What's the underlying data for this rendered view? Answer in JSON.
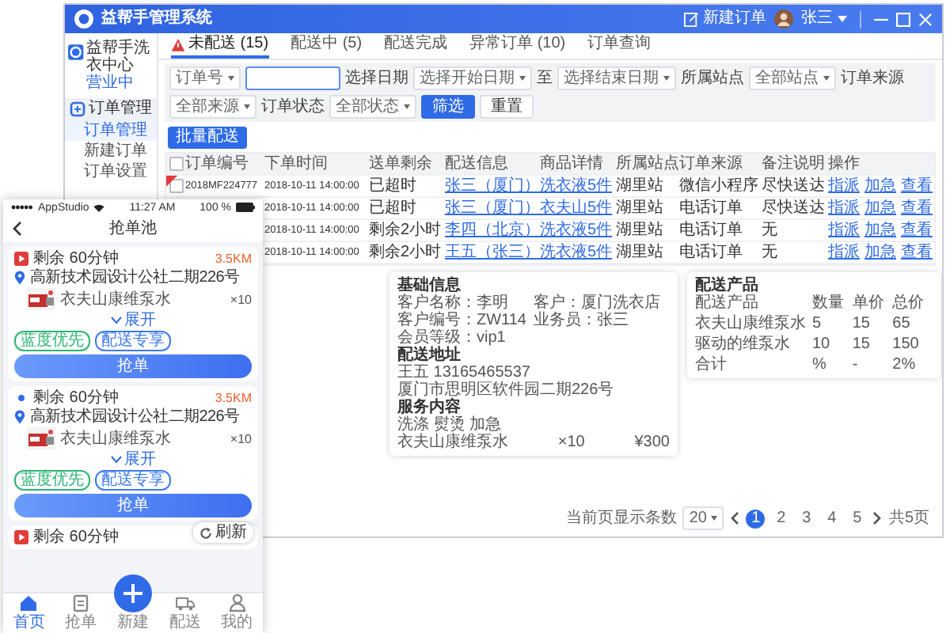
{
  "app": {
    "title": "益帮手管理系统",
    "new_order": "新建订单",
    "user": "张三"
  },
  "sidebar": {
    "shop_name": "益帮手洗衣中心",
    "shop_status": "营业中",
    "sections": [
      {
        "label": "订单管理",
        "expanded": true,
        "children": [
          {
            "label": "订单管理",
            "selected": true
          },
          {
            "label": "新建订单",
            "selected": false
          },
          {
            "label": "订单设置",
            "selected": false
          }
        ]
      }
    ]
  },
  "tabs": [
    {
      "label": "未配送 (15)",
      "alert": true,
      "selected": true
    },
    {
      "label": "配送中 (5)",
      "alert": false,
      "selected": false
    },
    {
      "label": "配送完成",
      "alert": false,
      "selected": false
    },
    {
      "label": "异常订单 (10)",
      "alert": false,
      "selected": false
    },
    {
      "label": "订单查询",
      "alert": false,
      "selected": false
    }
  ],
  "filters": [
    {
      "kind": "select",
      "value": "订单号"
    },
    {
      "kind": "input"
    },
    {
      "kind": "label",
      "text": "选择日期"
    },
    {
      "kind": "select",
      "value": "选择开始日期"
    },
    {
      "kind": "label",
      "text": "至"
    },
    {
      "kind": "select",
      "value": "选择结束日期"
    },
    {
      "kind": "label",
      "text": "所属站点"
    },
    {
      "kind": "select",
      "value": "全部站点"
    },
    {
      "kind": "label",
      "text": "订单来源"
    },
    {
      "kind": "select",
      "value": "全部来源"
    },
    {
      "kind": "label",
      "text": "订单状态"
    },
    {
      "kind": "select",
      "value": "全部状态"
    },
    {
      "kind": "button",
      "text": "筛选",
      "primary": true
    },
    {
      "kind": "button",
      "text": "重置",
      "primary": false
    }
  ],
  "batch_button": "批量配送",
  "table": {
    "all_checked": false,
    "columns": [
      "订单编号",
      "下单时间",
      "送单剩余",
      "配送信息",
      "商品详情",
      "所属站点",
      "订单来源",
      "备注说明",
      "操作"
    ],
    "rows": [
      {
        "flagged": true,
        "checked": false,
        "order_no": "2018MF224777",
        "time": "2018-10-11 14:00:00",
        "remaining": "已超时",
        "delivery": "张三（厦门）",
        "product": "洗衣液5件",
        "station": "湖里站",
        "source": "微信小程序",
        "note": "尽快送达",
        "actions": [
          "指派",
          "加急",
          "查看"
        ]
      },
      {
        "time": "2018-10-11 14:00:00",
        "remaining": "已超时",
        "delivery": "张三（厦门）",
        "product": "衣夫山5件",
        "station": "湖里站",
        "source": "电话订单",
        "note": "尽快送达",
        "actions": [
          "指派",
          "加急",
          "查看"
        ]
      },
      {
        "time": "2018-10-11 14:00:00",
        "remaining": "剩余2小时",
        "delivery": "李四（北京）",
        "product": "洗衣液5件",
        "station": "湖里站",
        "source": "电话订单",
        "note": "无",
        "actions": [
          "指派",
          "加急",
          "查看"
        ]
      },
      {
        "time": "2018-10-11 14:00:00",
        "remaining": "剩余2小时",
        "delivery": "王五（张三）",
        "product": "洗衣液5件",
        "station": "湖里站",
        "source": "电话订单",
        "note": "无",
        "actions": [
          "指派",
          "加急",
          "查看"
        ]
      }
    ]
  },
  "info_card": {
    "title": "基础信息",
    "fields": [
      "客户名称：李明",
      "客户：厦门洗衣店",
      "客户编号：ZW114",
      "业务员：张三",
      "会员等级：vip1"
    ],
    "address_title": "配送地址",
    "contact": "王五  13165465537",
    "address": "厦门市思明区软件园二期226号",
    "service_title": "服务内容",
    "services": "洗涤 熨烫 加急",
    "product": {
      "name": "衣夫山康维泵水",
      "qty": "×10",
      "price": "¥300"
    }
  },
  "products_card": {
    "title": "配送产品",
    "columns": [
      "配送产品",
      "数量",
      "单价",
      "总价"
    ],
    "rows": [
      [
        "衣夫山康维泵水",
        "5",
        "15",
        "65"
      ],
      [
        "驱动的维泵水",
        "10",
        "15",
        "150"
      ],
      [
        "合计",
        "%",
        "-",
        "2%"
      ]
    ]
  },
  "pagination": {
    "label": "当前页显示条数",
    "size": "20",
    "pages": [
      {
        "label": "1",
        "selected": true
      },
      {
        "label": "2",
        "selected": false
      },
      {
        "label": "3",
        "selected": false
      },
      {
        "label": "4",
        "selected": false
      },
      {
        "label": "5",
        "selected": false
      }
    ],
    "total": "共5页"
  },
  "phone": {
    "carrier": "AppStudio",
    "time": "11:27 AM",
    "battery": "100 %",
    "title": "抢单池",
    "cards": [
      {
        "urgent": true,
        "remain": "剩余 60分钟",
        "distance": "3.5KM",
        "address": "高新技术园设计公社二期226号",
        "item": "衣夫山康维泵水",
        "qty": "×10",
        "expand": "展开",
        "tags": [
          {
            "label": "蓝度优先",
            "color": "#2bb673"
          },
          {
            "label": "配送专享",
            "color": "#3d7bf0"
          }
        ],
        "button": "抢单"
      },
      {
        "urgent": false,
        "remain": "剩余 60分钟",
        "distance": "3.5KM",
        "address": "高新技术园设计公社二期226号",
        "item": "衣夫山康维泵水",
        "qty": "×10",
        "expand": "展开",
        "tags": [
          {
            "label": "蓝度优先",
            "color": "#2bb673"
          },
          {
            "label": "配送专享",
            "color": "#3d7bf0"
          }
        ],
        "button": "抢单"
      },
      {
        "urgent": true,
        "remain": "剩余 60分钟"
      }
    ],
    "refresh": "刷新",
    "tabs": [
      {
        "label": "首页",
        "kind": "normal",
        "selected": true
      },
      {
        "label": "抢单",
        "kind": "normal",
        "selected": false
      },
      {
        "label": "新建",
        "kind": "add",
        "selected": false
      },
      {
        "label": "配送",
        "kind": "normal",
        "selected": false
      },
      {
        "label": "我的",
        "kind": "normal",
        "selected": false
      }
    ]
  }
}
